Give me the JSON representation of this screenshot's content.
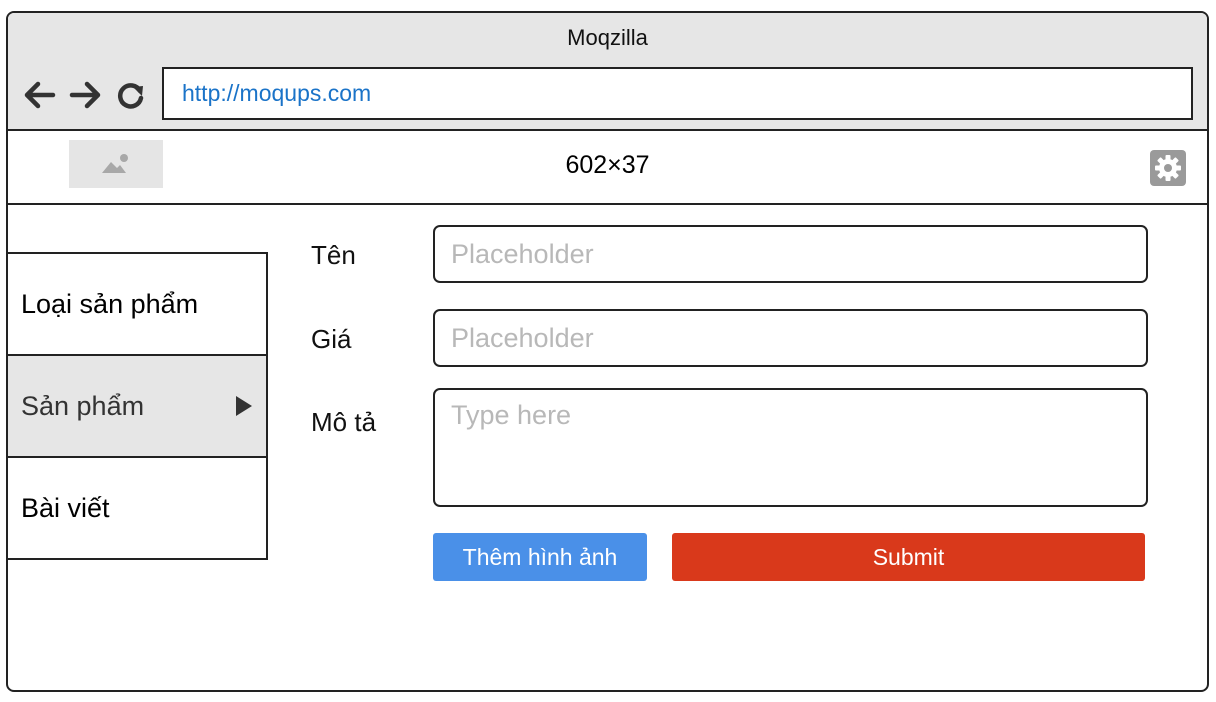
{
  "browser": {
    "title": "Moqzilla",
    "url": "http://moqups.com",
    "icons": [
      "back-arrow-icon",
      "forward-arrow-icon",
      "reload-icon"
    ]
  },
  "appbar": {
    "logo_icon": "image-placeholder-icon",
    "title": "602×37",
    "settings_icon": "gear-icon"
  },
  "sidebar": {
    "items": [
      {
        "label": "Loại sản phẩm",
        "active": false
      },
      {
        "label": "Sản phẩm",
        "active": true
      },
      {
        "label": "Bài viết",
        "active": false
      }
    ]
  },
  "form": {
    "name_label": "Tên",
    "name_placeholder": "Placeholder",
    "price_label": "Giá",
    "price_placeholder": "Placeholder",
    "desc_label": "Mô tả",
    "desc_placeholder": "Type here",
    "add_image_label": "Thêm hình ảnh",
    "submit_label": "Submit"
  },
  "colors": {
    "url_text": "#1a73c8",
    "add_image_button": "#4a90e8",
    "submit_button": "#d9391b",
    "active_sidebar": "#e6e6e6"
  }
}
